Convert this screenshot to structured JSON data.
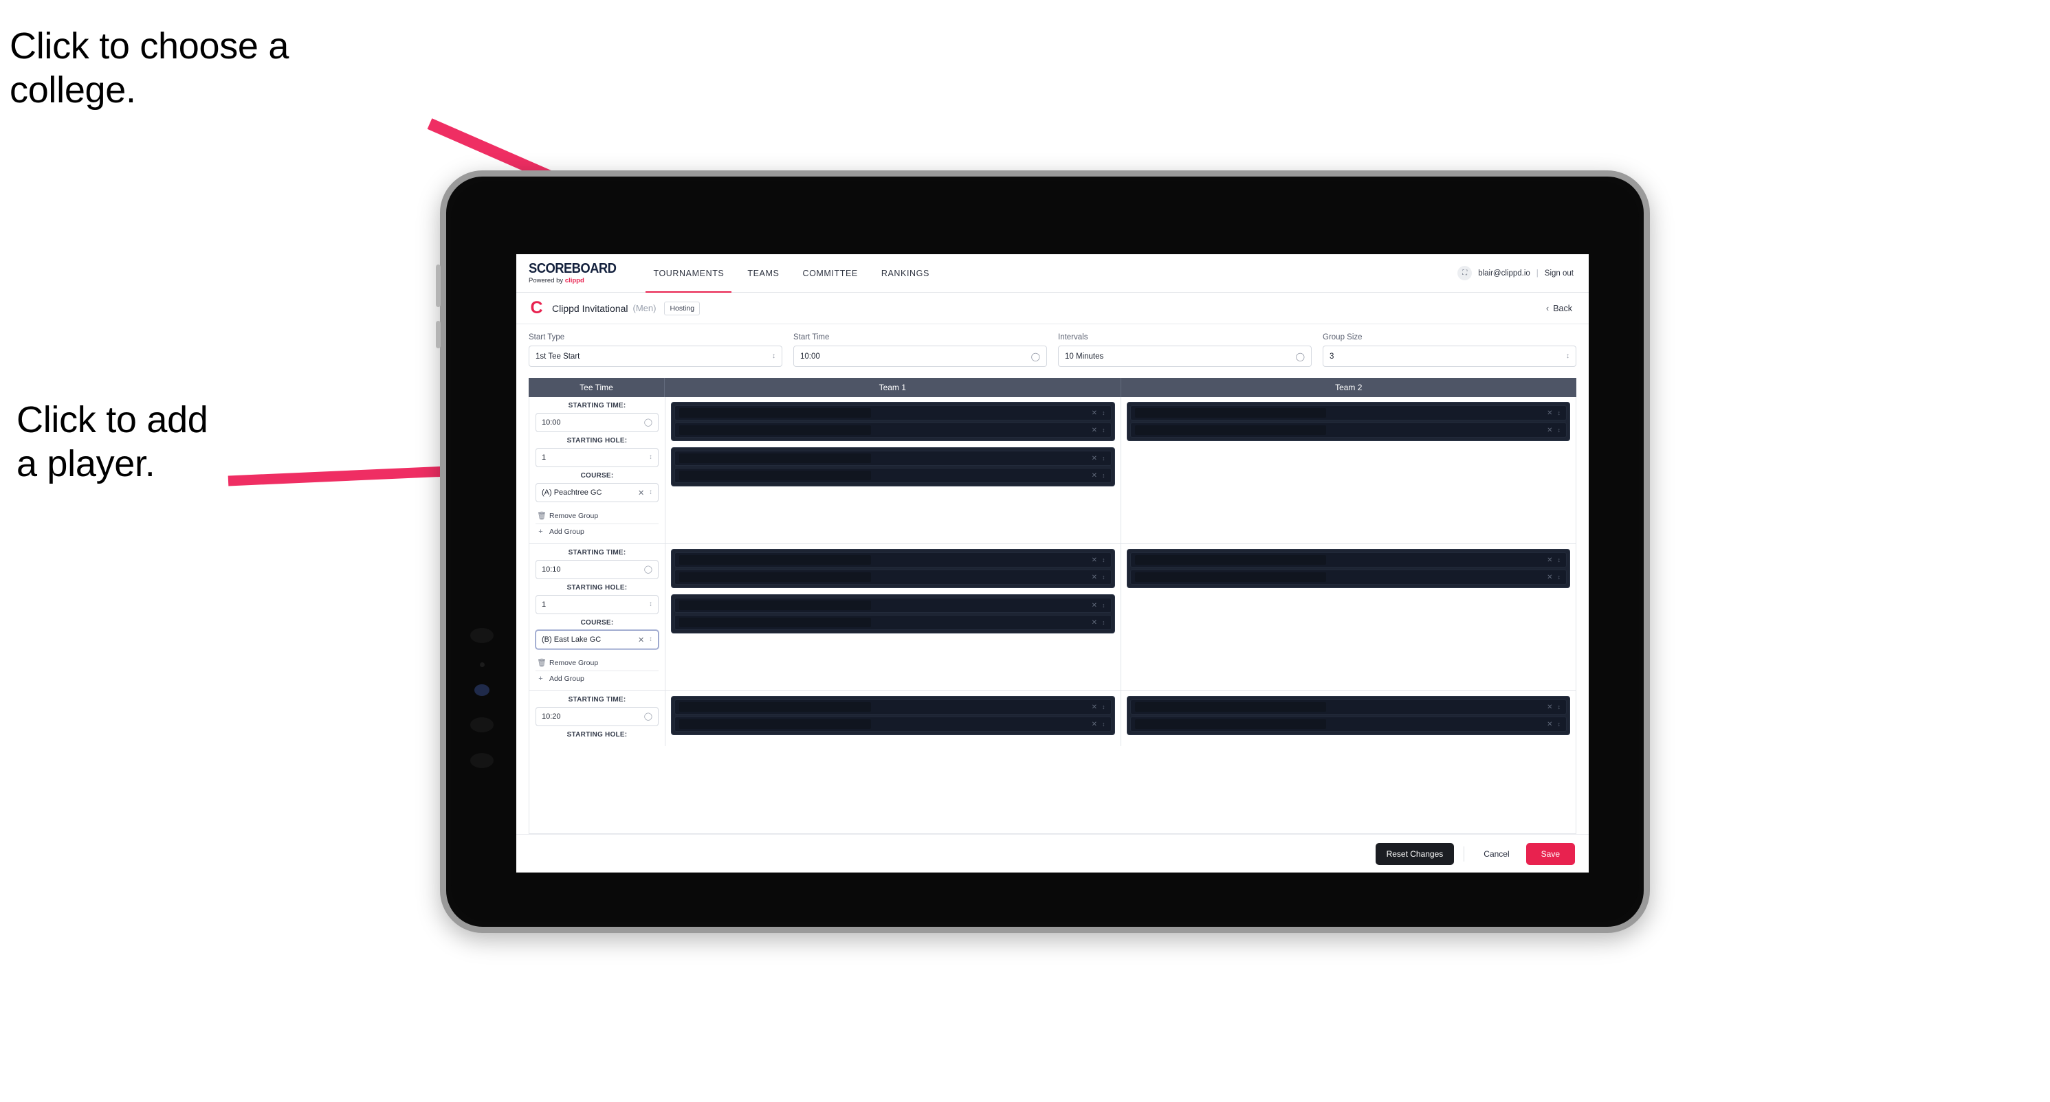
{
  "annotations": [
    {
      "id": "a1",
      "text": "Click to choose a\ncollege."
    },
    {
      "id": "a2",
      "text": "Click to add\na player."
    }
  ],
  "accent": {
    "pink": "#e8224f",
    "navy": "#14213d",
    "header_slate": "#4e5566",
    "dark_row": "#141a28"
  },
  "topnav": {
    "logo_main": "SCOREBOARD",
    "logo_sub_prefix": "Powered by ",
    "logo_sub_brand": "clippd",
    "tabs": [
      {
        "label": "TOURNAMENTS",
        "active": true
      },
      {
        "label": "TEAMS",
        "active": false
      },
      {
        "label": "COMMITTEE",
        "active": false
      },
      {
        "label": "RANKINGS",
        "active": false
      }
    ],
    "avatar_icon": "user-avatar-icon",
    "email": "blair@clippd.io",
    "separator": "|",
    "sign_out": "Sign out"
  },
  "breadcrumb": {
    "logo_letter": "C",
    "title": "Clippd Invitational",
    "gender": "(Men)",
    "badge": "Hosting",
    "back_label": "Back",
    "back_chevron": "‹"
  },
  "controls": [
    {
      "label": "Start Type",
      "value": "1st Tee Start",
      "icon": "stepper-icon"
    },
    {
      "label": "Start Time",
      "value": "10:00",
      "icon": "clock-icon"
    },
    {
      "label": "Intervals",
      "value": "10 Minutes",
      "icon": "clock-icon"
    },
    {
      "label": "Group Size",
      "value": "3",
      "icon": "stepper-icon"
    }
  ],
  "table": {
    "headers": [
      "Tee Time",
      "Team 1",
      "Team 2"
    ],
    "field_labels": {
      "time": "STARTING TIME:",
      "hole": "STARTING HOLE:",
      "course": "COURSE:"
    },
    "group_actions": {
      "remove": "Remove Group",
      "add": "Add Group"
    },
    "rows": [
      {
        "time": "10:00",
        "hole": "1",
        "course": "(A) Peachtree GC",
        "course_focused": false,
        "team1_groups": [
          {
            "players": 2
          },
          {
            "players": 2
          }
        ],
        "team2_groups": [
          {
            "players": 2
          }
        ]
      },
      {
        "time": "10:10",
        "hole": "1",
        "course": "(B) East Lake GC",
        "course_focused": true,
        "team1_groups": [
          {
            "players": 2
          },
          {
            "players": 2
          }
        ],
        "team2_groups": [
          {
            "players": 2
          }
        ]
      },
      {
        "time": "10:20",
        "hole": "",
        "course": "",
        "course_focused": false,
        "team1_groups": [
          {
            "players": 2
          }
        ],
        "team2_groups": [
          {
            "players": 2
          }
        ]
      }
    ]
  },
  "footer": {
    "reset_label": "Reset Changes",
    "cancel_label": "Cancel",
    "save_label": "Save"
  }
}
